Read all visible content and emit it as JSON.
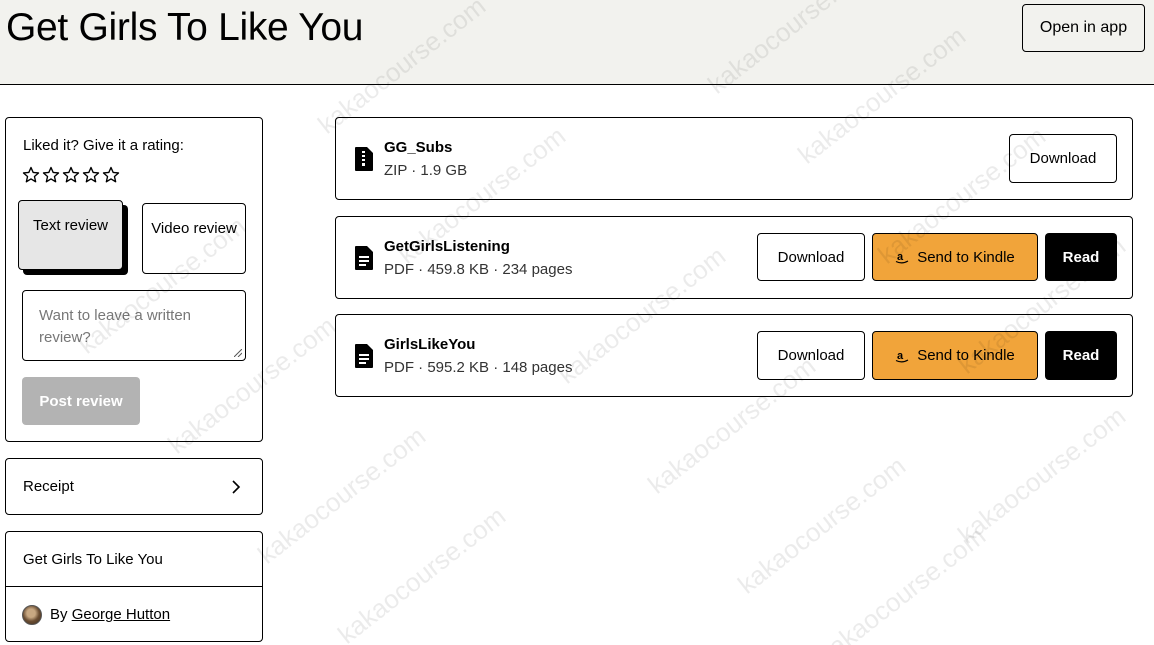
{
  "header": {
    "title": "Get Girls To Like You",
    "open_in_app_label": "Open in app"
  },
  "rating": {
    "prompt": "Liked it? Give it a rating:",
    "star_count": 5,
    "text_review_label": "Text review",
    "video_review_label": "Video review",
    "textarea_placeholder": "Want to leave a written review?",
    "post_review_label": "Post review"
  },
  "receipt": {
    "label": "Receipt"
  },
  "product": {
    "title": "Get Girls To Like You",
    "by_label": "By",
    "author": "George Hutton"
  },
  "files": [
    {
      "name": "GG_Subs",
      "meta": "ZIP · 1.9 GB",
      "icon": "zip-file-icon",
      "download_label": "Download"
    },
    {
      "name": "GetGirlsListening",
      "meta": "PDF · 459.8 KB · 234 pages",
      "icon": "document-icon",
      "download_label": "Download",
      "kindle_label": "Send to Kindle",
      "read_label": "Read"
    },
    {
      "name": "GirlsLikeYou",
      "meta": "PDF · 595.2 KB · 148 pages",
      "icon": "document-icon",
      "download_label": "Download",
      "kindle_label": "Send to Kindle",
      "read_label": "Read"
    }
  ],
  "watermark_text": "kakaocourse.com",
  "colors": {
    "header_bg": "#f2f2ee",
    "kindle_button": "#f1a43a",
    "read_button": "#000000",
    "disabled_button": "#b3b3b3"
  }
}
